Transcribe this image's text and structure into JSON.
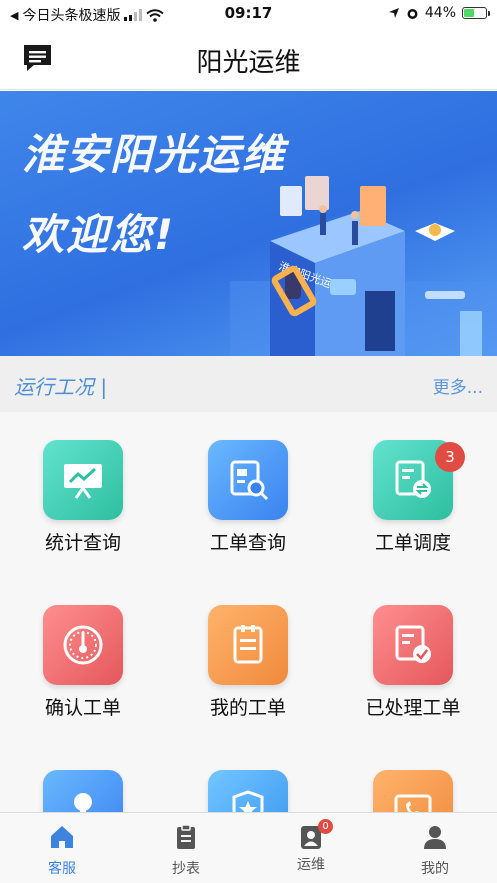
{
  "status_bar": {
    "back_app": "今日头条极速版",
    "time": "09:17",
    "battery": "44%",
    "battery_level": 0.44
  },
  "nav": {
    "title": "阳光运维",
    "left_icon": "message-icon"
  },
  "banner": {
    "line1": "淮安阳光运维",
    "line2": "欢迎您!",
    "building_sign": "淮安阳光运维"
  },
  "section": {
    "title": "运行工况 |",
    "more": "更多..."
  },
  "grid": [
    {
      "label": "统计查询",
      "icon": "chart-board-icon",
      "color": "#3fcfb3"
    },
    {
      "label": "工单查询",
      "icon": "document-search-icon",
      "color": "#4c95f5"
    },
    {
      "label": "工单调度",
      "icon": "document-swap-icon",
      "color": "#3fcfb3",
      "badge": "3"
    },
    {
      "label": "确认工单",
      "icon": "gauge-icon",
      "color": "#ec6b6e"
    },
    {
      "label": "我的工单",
      "icon": "clipboard-icon",
      "color": "#f39a4c"
    },
    {
      "label": "已处理工单",
      "icon": "document-check-icon",
      "color": "#ec6b6e"
    },
    {
      "label": "",
      "icon": "key-icon",
      "color": "#4c95f5"
    },
    {
      "label": "",
      "icon": "shield-star-icon",
      "color": "#4ca8f5"
    },
    {
      "label": "",
      "icon": "phone-card-icon",
      "color": "#f39a4c"
    }
  ],
  "tabbar": {
    "tabs": [
      {
        "label": "客服",
        "icon": "home-icon",
        "active": true
      },
      {
        "label": "抄表",
        "icon": "clipboard-icon",
        "active": false
      },
      {
        "label": "运维",
        "icon": "user-badge-icon",
        "active": false,
        "badge": "0"
      },
      {
        "label": "我的",
        "icon": "person-icon",
        "active": false
      }
    ]
  },
  "colors": {
    "accent": "#3d84e0",
    "banner": "#3a7ce6",
    "badge": "#e04b43"
  }
}
